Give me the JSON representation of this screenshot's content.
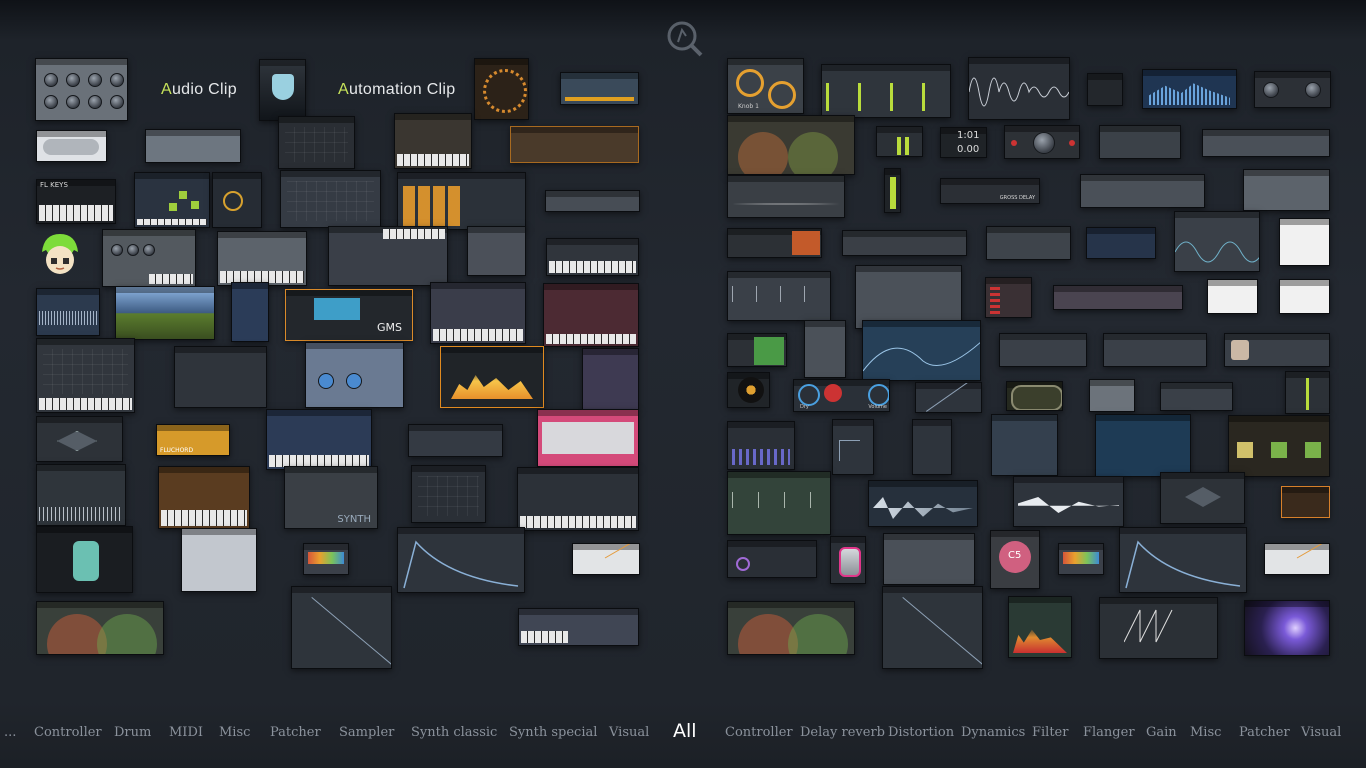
{
  "clip_labels": {
    "audio": {
      "first": "A",
      "rest": "udio Clip"
    },
    "automation": {
      "first": "A",
      "rest": "utomation Clip"
    }
  },
  "thumb_texts": {
    "flkeys": "FL KEYS",
    "gms": "GMS",
    "delay": "GROSS DELAY",
    "synth": "SYNTH",
    "knob_label": "Knob 1",
    "time1": "1:01",
    "time2": "0.00",
    "c5": "C5",
    "dry": "Dry",
    "vol": "Volume",
    "ducking": "FLUCHORD"
  },
  "tabs": {
    "ellipsis": "...",
    "gen": [
      "Controller",
      "Drum",
      "MIDI",
      "Misc",
      "Patcher",
      "Sampler",
      "Synth classic",
      "Synth special",
      "Visual"
    ],
    "all": "All",
    "fx": [
      "Controller",
      "Delay reverb",
      "Distortion",
      "Dynamics",
      "Filter",
      "Flanger",
      "Gain",
      "Misc",
      "Patcher",
      "Visual"
    ]
  },
  "colors": {
    "accent": "#c6e25a",
    "background": "#20252c",
    "tab_text": "#8b929c",
    "tab_active": "#ffffff"
  }
}
